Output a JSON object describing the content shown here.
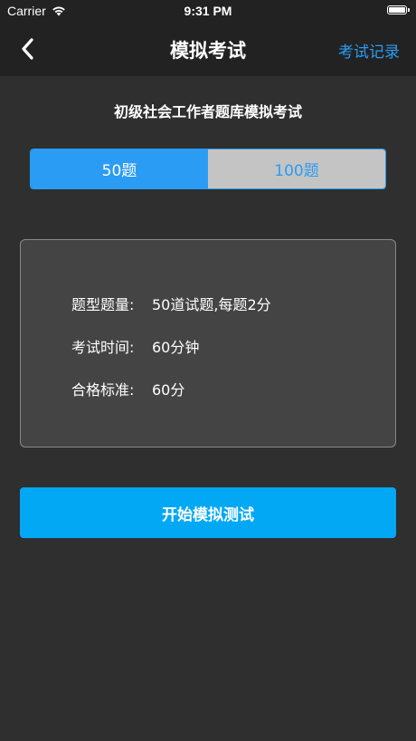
{
  "status_bar": {
    "carrier": "Carrier",
    "time": "9:31 PM"
  },
  "nav": {
    "title": "模拟考试",
    "right_label": "考试记录",
    "accent_color": "#2b9cf3"
  },
  "subtitle": "初级社会工作者题库模拟考试",
  "segments": [
    {
      "label": "50题",
      "selected": true
    },
    {
      "label": "100题",
      "selected": false
    }
  ],
  "info": {
    "rows": [
      {
        "label": "题型题量:",
        "value": "50道试题,每题2分"
      },
      {
        "label": "考试时间:",
        "value": "60分钟"
      },
      {
        "label": "合格标准:",
        "value": "60分"
      }
    ]
  },
  "start_button": {
    "label": "开始模拟测试",
    "color": "#03a8f4"
  },
  "icons": [
    "wifi-icon",
    "battery-icon",
    "back-chevron-icon"
  ]
}
